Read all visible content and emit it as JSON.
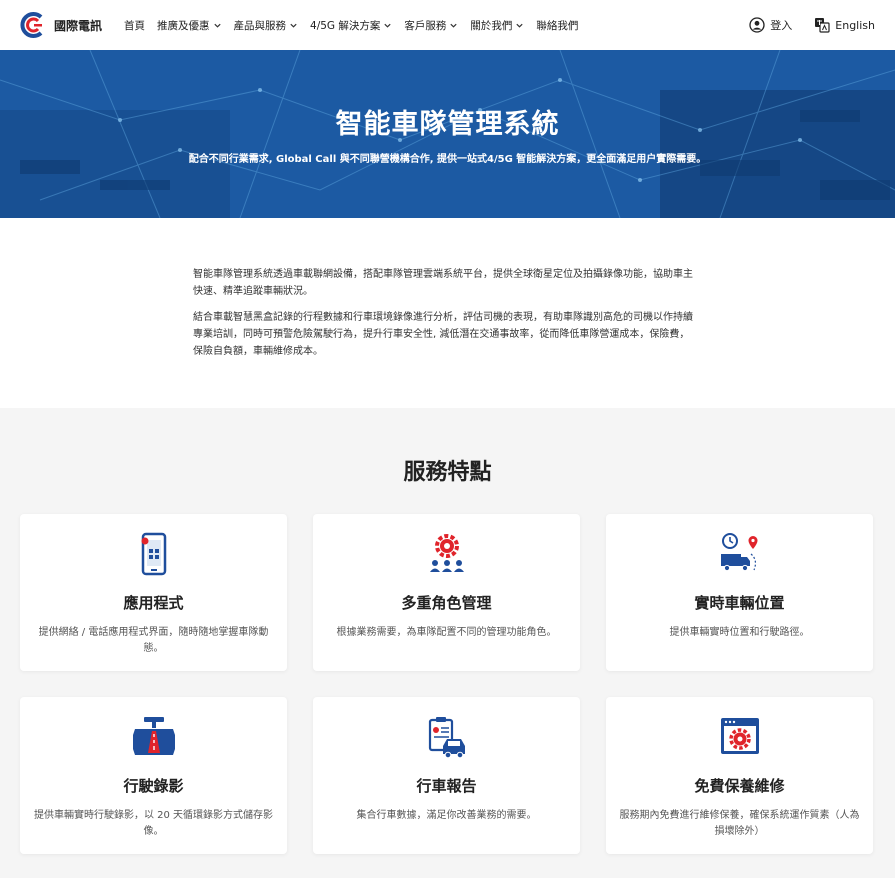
{
  "header": {
    "logo_text": "國際電訊",
    "nav": [
      {
        "label": "首頁",
        "has_dropdown": false
      },
      {
        "label": "推廣及優惠",
        "has_dropdown": true
      },
      {
        "label": "產品與服務",
        "has_dropdown": true
      },
      {
        "label": "4/5G 解決方案",
        "has_dropdown": true
      },
      {
        "label": "客戶服務",
        "has_dropdown": true
      },
      {
        "label": "關於我們",
        "has_dropdown": true
      },
      {
        "label": "聯絡我們",
        "has_dropdown": false
      }
    ],
    "login_label": "登入",
    "language_label": "English"
  },
  "hero": {
    "title": "智能車隊管理系統",
    "subtitle": "配合不同行業需求, Global Call 與不同聯營機構合作, 提供一站式4/5G 智能解決方案，更全面滿足用户實際需要。"
  },
  "intro": {
    "paragraphs": [
      "智能車隊管理系統透過車載聯網設備，搭配車隊管理雲端系統平台，提供全球衛星定位及拍攝錄像功能，協助車主快速、精準追蹤車輛狀況。",
      "結合車載智慧黑盒記錄的行程數據和行車環境錄像進行分析，評估司機的表現，有助車隊識別高危的司機以作持續專業培訓，同時可預警危險駕駛行為，提升行車安全性, 減低潛在交通事故率，從而降低車隊營運成本，保險費，保險自負額，車輛維修成本。"
    ]
  },
  "features": {
    "title": "服務特點",
    "cards": [
      {
        "icon": "mobile-app-icon",
        "title": "應用程式",
        "desc": "提供網絡 / 電話應用程式界面，隨時隨地掌握車隊動態。"
      },
      {
        "icon": "multi-role-gear-icon",
        "title": "多重角色管理",
        "desc": "根據業務需要，為車隊配置不同的管理功能角色。"
      },
      {
        "icon": "truck-location-icon",
        "title": "實時車輛位置",
        "desc": "提供車輛實時位置和行駛路徑。"
      },
      {
        "icon": "dashcam-road-icon",
        "title": "行駛錄影",
        "desc": "提供車輛實時行駛錄影，以 20 天循環錄影方式儲存影像。"
      },
      {
        "icon": "report-car-icon",
        "title": "行車報告",
        "desc": "集合行車數據，滿足你改善業務的需要。"
      },
      {
        "icon": "maintenance-gear-icon",
        "title": "免費保養維修",
        "desc": "服務期內免費進行維修保養，確保系統運作質素（人為損壞除外）"
      }
    ]
  },
  "colors": {
    "brand_blue": "#1f4e9c",
    "brand_red": "#e0242b",
    "hero_blue": "#1d5ea9"
  }
}
